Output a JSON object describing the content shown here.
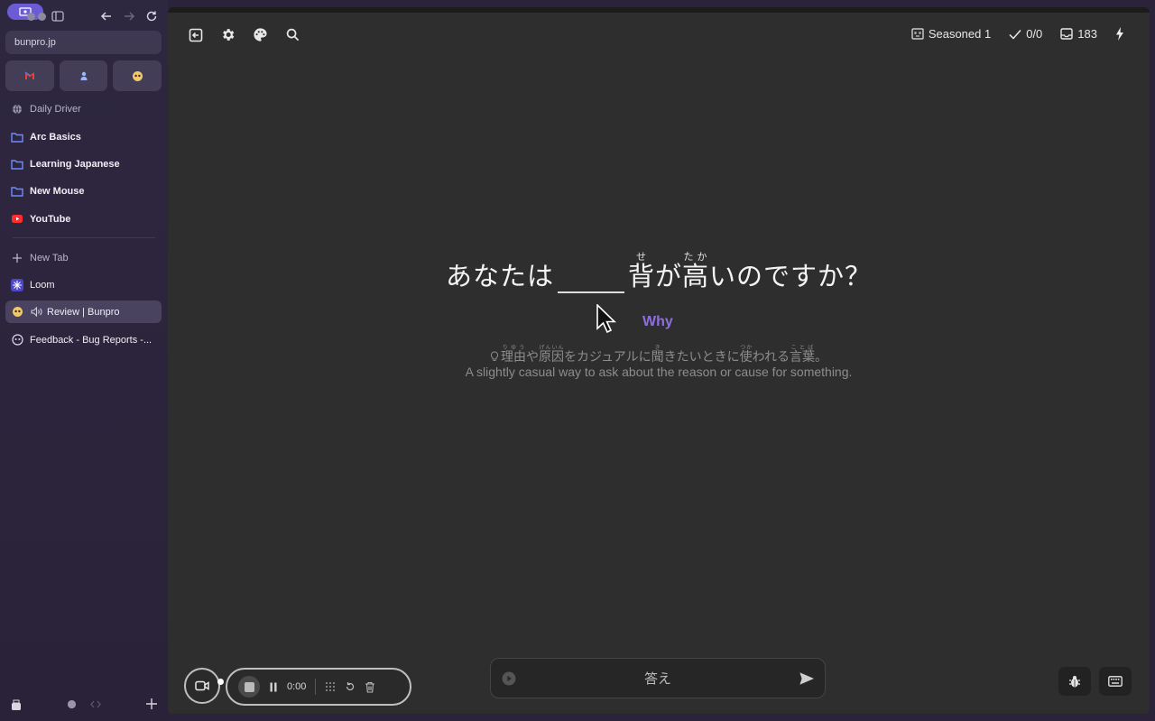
{
  "browser": {
    "url": "bunpro.jp",
    "favorites": [
      {
        "name": "gmail-icon"
      },
      {
        "name": "notion-like-icon"
      },
      {
        "name": "bunpro-icon"
      }
    ],
    "space_name": "Daily Driver",
    "pinned": [
      {
        "label": "Arc Basics",
        "icon": "folder-icon"
      },
      {
        "label": "Learning Japanese",
        "icon": "folder-icon"
      },
      {
        "label": "New Mouse",
        "icon": "folder-icon"
      },
      {
        "label": "YouTube",
        "icon": "youtube-icon"
      }
    ],
    "new_tab_label": "New Tab",
    "tabs": [
      {
        "label": "Loom",
        "icon": "loom-icon"
      },
      {
        "label": "Review | Bunpro",
        "icon": "bunpro-icon",
        "active": true,
        "audio": true
      },
      {
        "label": "Feedback - Bug Reports -...",
        "icon": "bunpro-icon"
      }
    ]
  },
  "review": {
    "toolbar": {
      "deck_label": "Seasoned 1",
      "score": "0/0",
      "reviews_count": "183"
    },
    "question": {
      "before": "あなたは",
      "after_parts": [
        {
          "kanji": "背",
          "reading": "せ"
        },
        {
          "text": "が"
        },
        {
          "kanji": "高",
          "reading": "たか"
        },
        {
          "text": "いのですか？"
        }
      ]
    },
    "hint_label": "Why",
    "hint_jp": [
      {
        "kanji": "理由",
        "reading": "りゆう"
      },
      {
        "text": "や"
      },
      {
        "kanji": "原因",
        "reading": "げんいん"
      },
      {
        "text": "をカジュアルに"
      },
      {
        "kanji": "聞",
        "reading": "き"
      },
      {
        "text": "きたいときに"
      },
      {
        "kanji": "使",
        "reading": "つか"
      },
      {
        "text": "われる"
      },
      {
        "kanji": "言葉",
        "reading": "ことば"
      },
      {
        "text": "。"
      }
    ],
    "hint_en": "A slightly casual way to ask about the reason or cause for something.",
    "answer_placeholder": "答え"
  },
  "recorder": {
    "timer": "0:00"
  },
  "colors": {
    "accent": "#8f6fe0",
    "sidebar_bg": "#2e2740",
    "main_bg": "#2e2e2e"
  }
}
